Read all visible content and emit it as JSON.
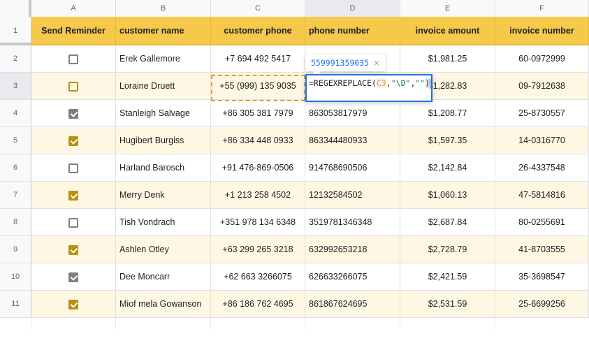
{
  "columns": [
    "A",
    "B",
    "C",
    "D",
    "E",
    "F"
  ],
  "active_column": "D",
  "active_row": 3,
  "header_row": {
    "row_number": "1",
    "cells": [
      "Send Reminder",
      "customer name",
      "customer phone",
      "phone number",
      "invoice amount",
      "invoice number"
    ]
  },
  "rows": [
    {
      "row_number": "2",
      "send_reminder": false,
      "customer_name": "Erek Gallemore",
      "customer_phone": "+7 694 492 5417",
      "phone_number": "",
      "invoice_amount": "$1,981.25",
      "invoice_number": "60-0972999"
    },
    {
      "row_number": "3",
      "send_reminder": false,
      "customer_name": "Loraine Druett",
      "customer_phone": "+55 (999) 135 9035",
      "phone_number": "",
      "invoice_amount": "$1,282.83",
      "invoice_number": "09-7912638"
    },
    {
      "row_number": "4",
      "send_reminder": true,
      "customer_name": "Stanleigh Salvage",
      "customer_phone": "+86 305 381 7979",
      "phone_number": "863053817979",
      "invoice_amount": "$1,208.77",
      "invoice_number": "25-8730557"
    },
    {
      "row_number": "5",
      "send_reminder": true,
      "customer_name": "Hugibert Burgiss",
      "customer_phone": "+86 334 448 0933",
      "phone_number": "863344480933",
      "invoice_amount": "$1,597.35",
      "invoice_number": "14-0316770"
    },
    {
      "row_number": "6",
      "send_reminder": false,
      "customer_name": "Harland Barosch",
      "customer_phone": "+91 476-869-0506",
      "phone_number": "914768690506",
      "invoice_amount": "$2,142.84",
      "invoice_number": "26-4337548"
    },
    {
      "row_number": "7",
      "send_reminder": true,
      "customer_name": "Merry Denk",
      "customer_phone": "+1 213 258 4502",
      "phone_number": "12132584502",
      "invoice_amount": "$1,060.13",
      "invoice_number": "47-5814816"
    },
    {
      "row_number": "8",
      "send_reminder": false,
      "customer_name": "Tish Vondrach",
      "customer_phone": "+351 978 134 6348",
      "phone_number": "3519781346348",
      "invoice_amount": "$2,687.84",
      "invoice_number": "80-0255691"
    },
    {
      "row_number": "9",
      "send_reminder": true,
      "customer_name": "Ashlen Otley",
      "customer_phone": "+63 299 265 3218",
      "phone_number": "632992653218",
      "invoice_amount": "$2,728.79",
      "invoice_number": "41-8703555"
    },
    {
      "row_number": "10",
      "send_reminder": true,
      "customer_name": "Dee Moncarr",
      "customer_phone": "+62 663 3266075",
      "phone_number": "626633266075",
      "invoice_amount": "$2,421.59",
      "invoice_number": "35-3698547"
    },
    {
      "row_number": "11",
      "send_reminder": true,
      "customer_name": "Miof mela Gowanson",
      "customer_phone": "+86 186 762 4695",
      "phone_number": "861867624695",
      "invoice_amount": "$2,531.59",
      "invoice_number": "25-6699256"
    }
  ],
  "formula_editor": {
    "prefix": "=REGEXREPLACE(",
    "ref": "C3",
    "sep1": ",",
    "arg2": "\"\\D\"",
    "sep2": ",",
    "arg3": "\"\"",
    "suffix": ")"
  },
  "formula_preview": {
    "value": "559991359035",
    "close_icon": "×"
  },
  "colors": {
    "header_fill": "#f6c94a",
    "band_fill": "#fdf7e3",
    "checkbox_gold": "#b89011",
    "checkbox_gray": "#7f7f7f",
    "editor_border": "#1a73e8",
    "copy_selection": "#e69c2a"
  }
}
